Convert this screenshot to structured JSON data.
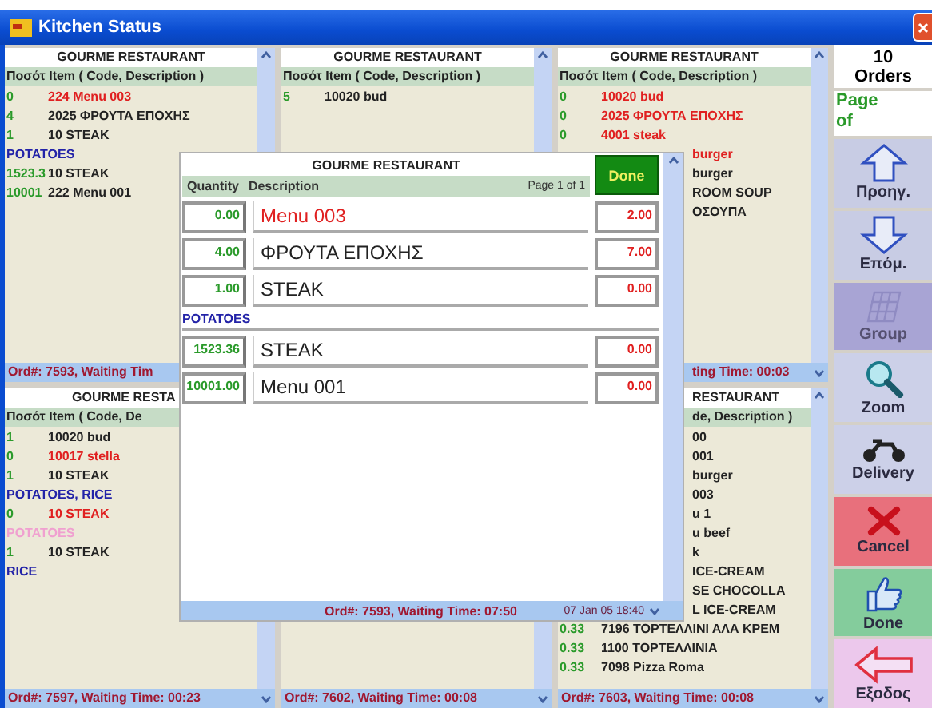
{
  "window": {
    "title": "Kitchen Status"
  },
  "panels": [
    {
      "header": {
        "text": "GOURME RESTAURANT",
        "cut": false
      },
      "columns": {
        "text": "Ποσότ Item ( Code, Description )",
        "cut": false
      },
      "items": [
        {
          "kind": "item",
          "qty": "0",
          "text": "224 Menu 003",
          "pending": true
        },
        {
          "kind": "item",
          "qty": "4",
          "text": "2025 ΦΡΟΥΤΑ ΕΠΟΧΗΣ",
          "pending": false
        },
        {
          "kind": "item",
          "qty": "1",
          "text": "10 STEAK",
          "pending": false
        },
        {
          "kind": "note",
          "text": "POTATOES",
          "color": "#2323a8"
        },
        {
          "kind": "item",
          "qty": "1523.3",
          "text": "10 STEAK",
          "pending": false
        },
        {
          "kind": "item",
          "qty": "10001",
          "text": "222 Menu 001",
          "pending": false
        }
      ],
      "footer": {
        "text": "Ord#: 7593, Waiting Tim",
        "cut": false
      }
    },
    {
      "header": {
        "text": "GOURME RESTAURANT",
        "cut": false
      },
      "columns": {
        "text": "Ποσότ Item ( Code, Description )",
        "cut": false
      },
      "items": [
        {
          "kind": "item",
          "qty": "5",
          "text": "10020 bud",
          "pending": false
        }
      ]
    },
    {
      "header": {
        "text": "GOURME RESTAURANT",
        "cut": false
      },
      "columns": {
        "text": "Ποσότ Item ( Code, Description )",
        "cut": false
      },
      "items": [
        {
          "kind": "item",
          "qty": "0",
          "text": "10020 bud",
          "pending": true
        },
        {
          "kind": "item",
          "qty": "0",
          "text": "2025 ΦΡΟΥΤΑ ΕΠΟΧΗΣ",
          "pending": true
        },
        {
          "kind": "item",
          "qty": "0",
          "text": "4001 steak",
          "pending": true
        },
        {
          "kind": "fragment",
          "text": "burger",
          "pending": true
        },
        {
          "kind": "fragment",
          "text": "burger",
          "pending": false
        },
        {
          "kind": "fragment",
          "text": "ROOM SOUP",
          "pending": false
        },
        {
          "kind": "fragment",
          "text": "ΟΣΟΥΠΑ",
          "pending": false
        }
      ],
      "footer": {
        "text": "ting Time: 00:03",
        "cut": true
      }
    },
    {
      "header": {
        "text": "GOURME RESTA",
        "cut": true
      },
      "columns": {
        "text": "Ποσότ Item ( Code, De",
        "cut": false
      },
      "items": [
        {
          "kind": "item",
          "qty": "1",
          "text": "10020 bud",
          "pending": false
        },
        {
          "kind": "item",
          "qty": "0",
          "text": "10017 stella",
          "pending": true
        },
        {
          "kind": "item",
          "qty": "1",
          "text": "10 STEAK",
          "pending": false
        },
        {
          "kind": "note",
          "text": "POTATOES, RICE",
          "color": "#2323a8"
        },
        {
          "kind": "item",
          "qty": "0",
          "text": "10 STEAK",
          "pending": true
        },
        {
          "kind": "note",
          "text": "POTATOES",
          "color": "#f0a0d0"
        },
        {
          "kind": "item",
          "qty": "1",
          "text": "10 STEAK",
          "pending": false
        },
        {
          "kind": "note",
          "text": "RICE",
          "color": "#2323a8"
        }
      ],
      "footer": {
        "text": "Ord#: 7597, Waiting Time: 00:23",
        "cut": false
      }
    },
    {
      "footer": {
        "text": "Ord#: 7602, Waiting Time: 00:08",
        "cut": false
      }
    },
    {
      "header": {
        "text": "RESTAURANT",
        "cut": true
      },
      "columns": {
        "text": "de, Description )",
        "cut": true
      },
      "items": [
        {
          "kind": "fragment",
          "text": "00",
          "pending": false
        },
        {
          "kind": "fragment",
          "text": "001",
          "pending": false
        },
        {
          "kind": "fragment",
          "text": "burger",
          "pending": false
        },
        {
          "kind": "fragment",
          "text": "003",
          "pending": false
        },
        {
          "kind": "fragment",
          "text": "u 1",
          "pending": false
        },
        {
          "kind": "fragment",
          "text": "u beef",
          "pending": false
        },
        {
          "kind": "fragment",
          "text": "k",
          "pending": false
        },
        {
          "kind": "fragment",
          "text": "ICE-CREAM",
          "pending": false
        },
        {
          "kind": "fragment",
          "text": "SE CHOCOLLA",
          "pending": false
        },
        {
          "kind": "fragment",
          "text": "L ICE-CREAM",
          "pending": false
        },
        {
          "kind": "item",
          "qty": "0.33",
          "text": "7196 ΤΟΡΤΕΛΛΙΝΙ ΑΛΑ ΚΡΕΜ",
          "pending": false
        },
        {
          "kind": "item",
          "qty": "0.33",
          "text": "1100 ΤΟΡΤΕΛΛΙΝΙΑ",
          "pending": false
        },
        {
          "kind": "item",
          "qty": "0.33",
          "text": "7098 Pizza Roma",
          "pending": false
        }
      ],
      "footer": {
        "text": "Ord#: 7603, Waiting Time: 00:08",
        "cut": false
      }
    }
  ],
  "detail": {
    "title": "GOURME RESTAURANT",
    "quantity_label": "Quantity",
    "description_label": "Description",
    "page": "Page 1 of 1",
    "done": "Done",
    "rows": [
      {
        "kind": "item",
        "qty": "0.00",
        "text": "Menu 003",
        "value": "2.00",
        "pending": true
      },
      {
        "kind": "item",
        "qty": "4.00",
        "text": "ΦΡΟΥΤΑ ΕΠΟΧΗΣ",
        "value": "7.00",
        "pending": false
      },
      {
        "kind": "item",
        "qty": "1.00",
        "text": "STEAK",
        "value": "0.00",
        "pending": false
      },
      {
        "kind": "note",
        "text": "POTATOES",
        "color": "#2323a8"
      },
      {
        "kind": "item",
        "qty": "1523.36",
        "text": "STEAK",
        "value": "0.00",
        "pending": false
      },
      {
        "kind": "item",
        "qty": "10001.00",
        "text": "Menu 001",
        "value": "0.00",
        "pending": false
      }
    ],
    "footer": "Ord#: 7593, Waiting Time: 07:50",
    "date": "07 Jan 05 18:40"
  },
  "sidebar": {
    "count": "10",
    "count_label": "Orders",
    "page_label": "Page",
    "of_label": "of",
    "buttons": [
      {
        "kind": "up",
        "label": "Προηγ.",
        "disabled": false
      },
      {
        "kind": "down",
        "label": "Επόμ.",
        "disabled": false
      },
      {
        "kind": "group",
        "label": "Group",
        "disabled": true
      },
      {
        "kind": "zoom",
        "label": "Zoom",
        "disabled": false
      },
      {
        "kind": "delivery",
        "label": "Delivery",
        "disabled": false
      },
      {
        "kind": "cancel",
        "label": "Cancel",
        "disabled": false
      },
      {
        "kind": "done",
        "label": "Done",
        "disabled": false
      },
      {
        "kind": "exit",
        "label": "Εξοδος",
        "disabled": false
      }
    ]
  }
}
